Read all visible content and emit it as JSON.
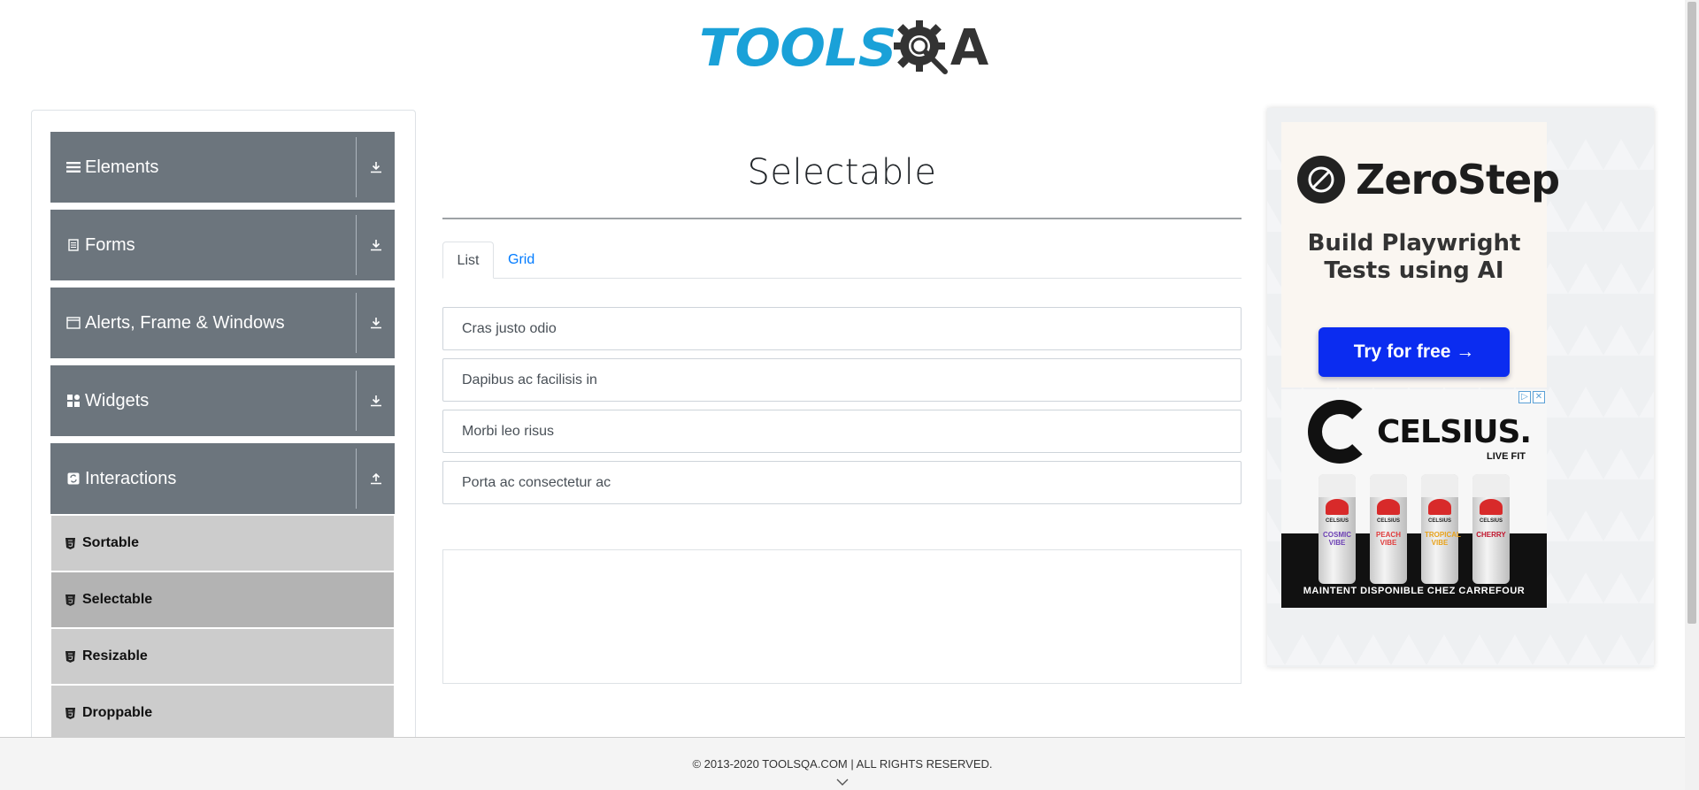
{
  "header": {
    "logo_text_primary": "TOOLS",
    "logo_text_secondary": "A"
  },
  "sidebar": {
    "groups": [
      {
        "label": "Elements",
        "icon": "hamburger-icon",
        "expanded": false
      },
      {
        "label": "Forms",
        "icon": "document-icon",
        "expanded": false
      },
      {
        "label": "Alerts, Frame & Windows",
        "icon": "window-icon",
        "expanded": false
      },
      {
        "label": "Widgets",
        "icon": "widgets-icon",
        "expanded": false
      },
      {
        "label": "Interactions",
        "icon": "interactions-icon",
        "expanded": true
      }
    ],
    "sub_items": [
      {
        "label": "Sortable",
        "active": false
      },
      {
        "label": "Selectable",
        "active": true
      },
      {
        "label": "Resizable",
        "active": false
      },
      {
        "label": "Droppable",
        "active": false
      }
    ]
  },
  "main": {
    "title": "Selectable",
    "tabs": [
      {
        "label": "List",
        "active": true
      },
      {
        "label": "Grid",
        "active": false
      }
    ],
    "list_items": [
      "Cras justo odio",
      "Dapibus ac facilisis in",
      "Morbi leo risus",
      "Porta ac consectetur ac"
    ]
  },
  "ad": {
    "zerostep_name": "ZeroStep",
    "zerostep_tagline_line1": "Build Playwright",
    "zerostep_tagline_line2": "Tests using AI",
    "zerostep_button": "Try for free →",
    "celsius_brand": "CELSIUS.",
    "celsius_tagline": "LIVE FIT",
    "celsius_cta": "MAINTENT DISPONIBLE CHEZ CARREFOUR",
    "cans": [
      {
        "brand": "CELSIUS",
        "flavor": "COSMIC VIBE"
      },
      {
        "brand": "CELSIUS",
        "flavor": "PEACH VIBE"
      },
      {
        "brand": "CELSIUS",
        "flavor": "TROPICAL VIBE"
      },
      {
        "brand": "CELSIUS",
        "flavor": "CHERRY"
      }
    ]
  },
  "footer": {
    "copyright": "© 2013-2020 TOOLSQA.COM | ALL RIGHTS RESERVED."
  },
  "colors": {
    "sidebar_group_bg": "#6c757d",
    "sidebar_sub_bg": "#cccccc",
    "sidebar_sub_active_bg": "#b3b3b3",
    "link_blue": "#007bff",
    "logo_blue": "#1aa1d8",
    "ad_button_blue": "#0b2cf0"
  }
}
